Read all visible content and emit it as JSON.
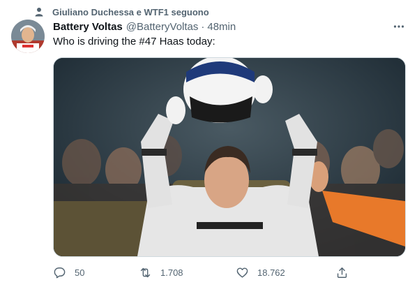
{
  "context": {
    "text": "Giuliano Duchessa e WTF1 seguono",
    "icon": "person-icon"
  },
  "tweet": {
    "author_name": "Battery Voltas",
    "author_handle": "@BatteryVoltas",
    "separator": "·",
    "time": "48min",
    "text": "Who is driving the #47 Haas today:"
  },
  "actions": {
    "reply_count": "50",
    "retweet_count": "1.708",
    "like_count": "18.762"
  },
  "colors": {
    "secondary_text": "#536471",
    "primary_text": "#0f1419",
    "border": "#cfd9de"
  }
}
